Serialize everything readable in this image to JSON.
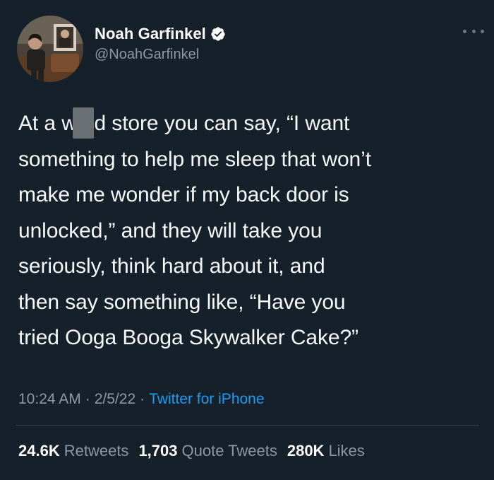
{
  "author": {
    "display_name": "Noah Garfinkel",
    "handle": "@NoahGarfinkel",
    "verified": true,
    "avatar_icon": "profile-photo"
  },
  "tweet": {
    "text": "At a w   d store you can say, “I want\nsomething to help me sleep that won’t\nmake me wonder if my back door is\nunlocked,” and they will take you\nseriously, think hard about it, and\nthen say something like, “Have you\ntried Ooga Booga Skywalker Cake?”"
  },
  "meta": {
    "time": "10:24 AM",
    "separator": "·",
    "date": "2/5/22",
    "source": "Twitter for iPhone"
  },
  "stats": {
    "retweets_value": "24.6K",
    "retweets_label": "Retweets",
    "quotes_value": "1,703",
    "quotes_label": "Quote Tweets",
    "likes_value": "280K",
    "likes_label": "Likes"
  },
  "colors": {
    "background": "#15202b",
    "link": "#1d9bf0",
    "secondary_text": "#8b98a5",
    "verified": "#1d9bf0"
  }
}
